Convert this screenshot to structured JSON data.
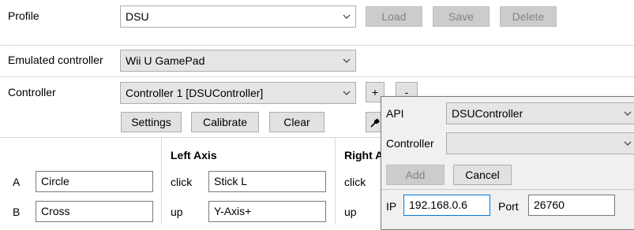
{
  "profile": {
    "label": "Profile",
    "value": "DSU",
    "load_label": "Load",
    "save_label": "Save",
    "delete_label": "Delete"
  },
  "emulated": {
    "label": "Emulated controller",
    "value": "Wii U GamePad"
  },
  "controller": {
    "label": "Controller",
    "value": "Controller 1 [DSUController]",
    "add_label": "+",
    "remove_label": "-",
    "settings_label": "Settings",
    "calibrate_label": "Calibrate",
    "clear_label": "Clear"
  },
  "mapping": {
    "left_axis_header": "Left Axis",
    "right_axis_header": "Right A",
    "buttons": [
      {
        "name": "A",
        "value": "Circle"
      },
      {
        "name": "B",
        "value": "Cross"
      }
    ],
    "left_axis": [
      {
        "name": "click",
        "value": "Stick L"
      },
      {
        "name": "up",
        "value": "Y-Axis+"
      }
    ],
    "right_axis": [
      {
        "name": "click"
      },
      {
        "name": "up"
      }
    ]
  },
  "popup": {
    "api_label": "API",
    "api_value": "DSUController",
    "controller_label": "Controller",
    "controller_value": "",
    "add_label": "Add",
    "cancel_label": "Cancel",
    "ip_label": "IP",
    "ip_value": "192.168.0.6",
    "port_label": "Port",
    "port_value": "26760"
  }
}
